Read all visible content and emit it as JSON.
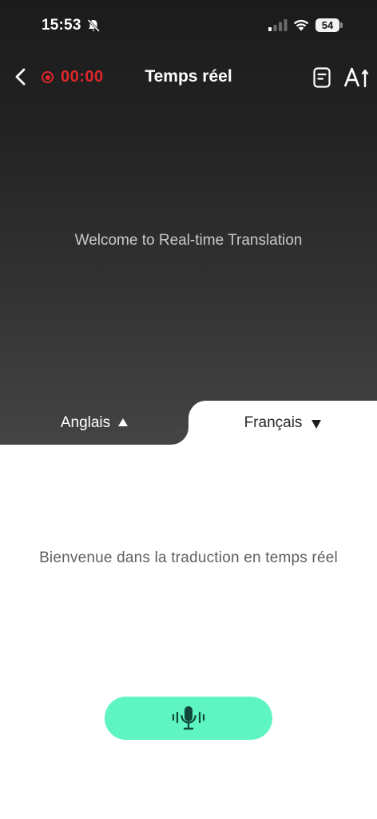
{
  "status_bar": {
    "time": "15:53",
    "battery": "54",
    "icons": [
      "bell-off-icon",
      "signal-icon",
      "wifi-icon",
      "battery-icon"
    ]
  },
  "header": {
    "back_icon": "chevron-left-icon",
    "record_icon": "record-dot-icon",
    "timer": "00:00",
    "title": "Temps réel",
    "notes_icon": "document-icon",
    "font_icon": "text-size-icon"
  },
  "source_panel": {
    "welcome_text": "Welcome to Real-time Translation"
  },
  "languages": {
    "source": "Anglais",
    "target": "Français"
  },
  "target_panel": {
    "welcome_text": "Bienvenue dans la traduction en temps réel"
  },
  "mic_button": {
    "icon": "microphone-icon"
  },
  "colors": {
    "record_red": "#e0262b",
    "mic_accent": "#5ef5c2",
    "dark_top": "#1b1b1b",
    "dark_bottom": "#444444"
  }
}
